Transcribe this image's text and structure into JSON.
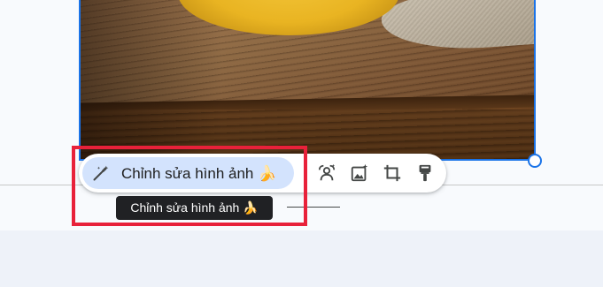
{
  "image_toolbar": {
    "edit_image_label": "Chỉnh sửa hình ảnh 🍌",
    "icons": [
      "magic-wand-icon",
      "remove-background-icon",
      "replace-image-icon",
      "crop-icon",
      "paint-format-icon"
    ]
  },
  "tooltip": {
    "text": "Chỉnh sửa hình ảnh 🍌"
  },
  "colors": {
    "selection_blue": "#1a73e8",
    "button_fill": "#d3e3fd",
    "tooltip_bg": "#202124",
    "highlight_red": "#e8213a"
  }
}
